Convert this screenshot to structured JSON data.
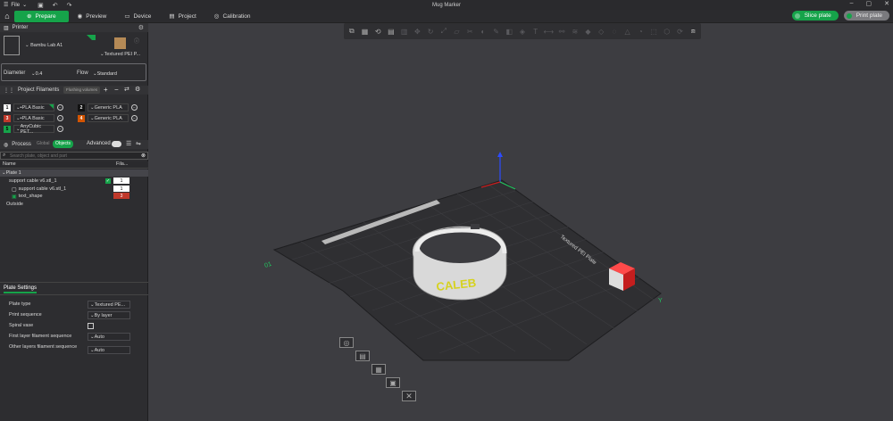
{
  "app": {
    "title": "Mug Marker",
    "menu_label": "File"
  },
  "nav": {
    "tabs": [
      {
        "label": "Prepare",
        "icon": "plus-icon"
      },
      {
        "label": "Preview",
        "icon": "eye-icon"
      },
      {
        "label": "Device",
        "icon": "device-icon"
      },
      {
        "label": "Project",
        "icon": "project-icon"
      },
      {
        "label": "Calibration",
        "icon": "calibration-icon"
      }
    ],
    "slice_label": "Slice plate",
    "print_label": "Print plate"
  },
  "printer": {
    "section_label": "Printer",
    "name": "Bambu Lab A1",
    "plate": "Textured PEI P...",
    "diameter_label": "Diameter",
    "diameter_value": "0.4",
    "flow_label": "Flow",
    "flow_value": "Standard"
  },
  "filaments": {
    "section_label": "Project Filaments",
    "flushing_label": "Flushing volumes",
    "items": [
      {
        "index": "1",
        "name": "PLA Basic",
        "color": "#ffffff",
        "text_color": "#000000"
      },
      {
        "index": "2",
        "name": "Generic PLA",
        "color": "#111111",
        "text_color": "#ffffff"
      },
      {
        "index": "3",
        "name": "PLA Basic",
        "color": "#c0392b",
        "text_color": "#ffffff"
      },
      {
        "index": "4",
        "name": "Generic PLA",
        "color": "#d35400",
        "text_color": "#ffffff"
      },
      {
        "index": "5",
        "name": "AnyCubic PET...",
        "color": "#16a34a",
        "text_color": "#000000"
      }
    ]
  },
  "process": {
    "section_label": "Process",
    "global_label": "Global",
    "objects_label": "Objects",
    "advanced_label": "Advanced",
    "search_placeholder": "Search plate, object and part",
    "col_name": "Name",
    "col_fil": "Fila...",
    "rows": [
      {
        "name": "Plate 1",
        "fil": "",
        "level": 0
      },
      {
        "name": "support cable v6.stl_1",
        "fil": "1",
        "level": 1
      },
      {
        "name": "support cable v6.stl_1",
        "fil": "1",
        "level": 2
      },
      {
        "name": "text_shape",
        "fil": "3",
        "level": 2
      },
      {
        "name": "Outside",
        "fil": "",
        "level": 1
      }
    ]
  },
  "plate_settings": {
    "tab_label": "Plate Settings",
    "rows": [
      {
        "label": "Plate type",
        "value": "Textured PE..."
      },
      {
        "label": "Print sequence",
        "value": "By layer"
      },
      {
        "label": "Spiral vase",
        "value": ""
      },
      {
        "label": "First layer filament sequence",
        "value": "Auto"
      },
      {
        "label": "Other layers filament sequence",
        "value": "Auto"
      }
    ]
  },
  "scene": {
    "model_text": "CALEB",
    "bed_label": "Textured PEI Plate",
    "plate_number": "01",
    "colors": {
      "accent": "#16a34a",
      "bed": "#303032",
      "model_text": "#d6d21e",
      "block": "#cc2222"
    }
  }
}
